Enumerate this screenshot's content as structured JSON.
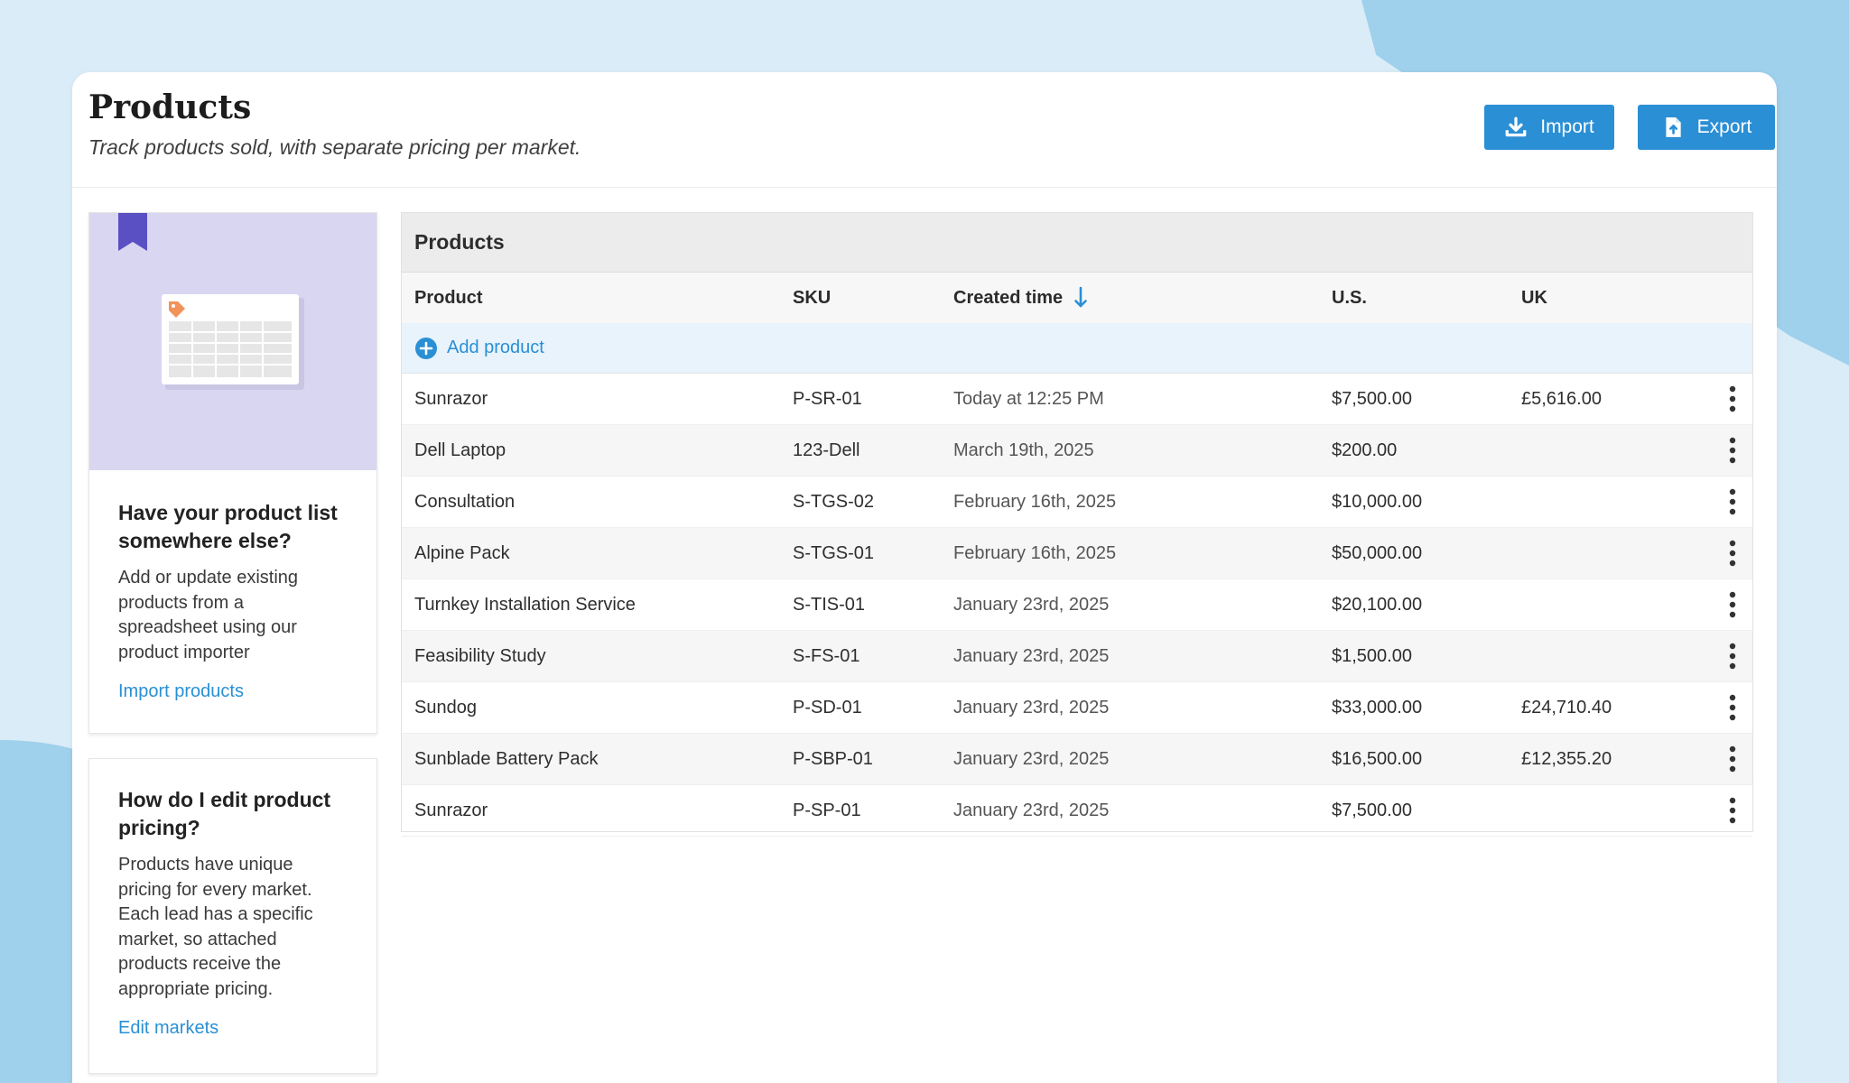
{
  "header": {
    "title": "Products",
    "subtitle": "Track products sold, with separate pricing per market.",
    "import_label": "Import",
    "export_label": "Export"
  },
  "cards": [
    {
      "title": "Have your product list somewhere else?",
      "text": "Add or update existing products from a spreadsheet using our product importer",
      "link": "Import products"
    },
    {
      "title": "How do I edit product pricing?",
      "text": "Products have unique pricing for every market. Each lead has a specific market, so attached products receive the appropriate pricing.",
      "link": "Edit markets"
    }
  ],
  "table": {
    "title": "Products",
    "columns": {
      "product": "Product",
      "sku": "SKU",
      "created": "Created time",
      "us": "U.S.",
      "uk": "UK"
    },
    "sort": {
      "column": "created",
      "direction": "descending"
    },
    "add_label": "Add product",
    "rows": [
      {
        "product": "Sunrazor",
        "sku": "P-SR-01",
        "created": "Today at 12:25 PM",
        "us": "$7,500.00",
        "uk": "£5,616.00"
      },
      {
        "product": "Dell Laptop",
        "sku": "123-Dell",
        "created": "March 19th, 2025",
        "us": "$200.00",
        "uk": ""
      },
      {
        "product": "Consultation",
        "sku": "S-TGS-02",
        "created": "February 16th, 2025",
        "us": "$10,000.00",
        "uk": ""
      },
      {
        "product": "Alpine Pack",
        "sku": "S-TGS-01",
        "created": "February 16th, 2025",
        "us": "$50,000.00",
        "uk": ""
      },
      {
        "product": "Turnkey Installation Service",
        "sku": "S-TIS-01",
        "created": "January 23rd, 2025",
        "us": "$20,100.00",
        "uk": ""
      },
      {
        "product": "Feasibility Study",
        "sku": "S-FS-01",
        "created": "January 23rd, 2025",
        "us": "$1,500.00",
        "uk": ""
      },
      {
        "product": "Sundog",
        "sku": "P-SD-01",
        "created": "January 23rd, 2025",
        "us": "$33,000.00",
        "uk": "£24,710.40"
      },
      {
        "product": "Sunblade Battery Pack",
        "sku": "P-SBP-01",
        "created": "January 23rd, 2025",
        "us": "$16,500.00",
        "uk": "£12,355.20"
      },
      {
        "product": "Sunrazor",
        "sku": "P-SP-01",
        "created": "January 23rd, 2025",
        "us": "$7,500.00",
        "uk": ""
      }
    ]
  },
  "colors": {
    "accent": "#2a8fd4",
    "card_hero": "#d8d6f1",
    "bookmark": "#5b4fc4",
    "background": "#d9ecf7"
  },
  "icons": {
    "import": "download-icon",
    "export": "file-export-icon",
    "sort": "arrow-down-icon",
    "add": "plus-circle-icon",
    "row_menu": "kebab-menu-icon",
    "bookmark": "bookmark-icon"
  }
}
